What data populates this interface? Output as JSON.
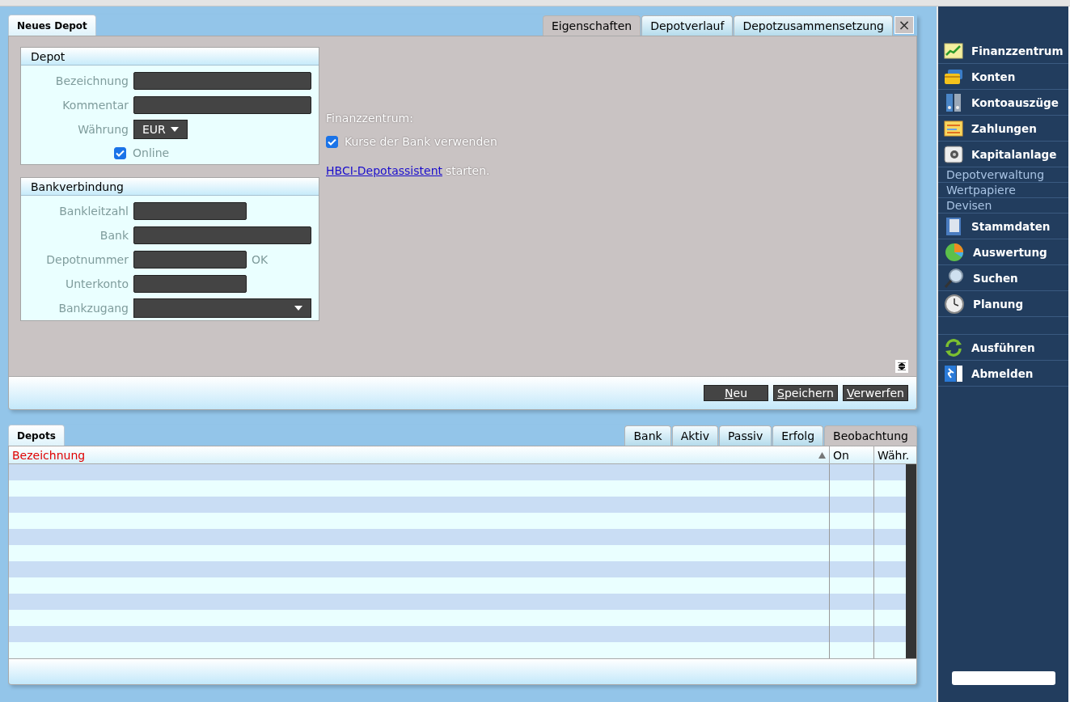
{
  "editor": {
    "title_tab": "Neues Depot",
    "tabs": [
      {
        "label": "Eigenschaften",
        "selected": true
      },
      {
        "label": "Depotverlauf",
        "selected": false
      },
      {
        "label": "Depotzusammensetzung",
        "selected": false
      }
    ],
    "close_button": "×",
    "depot_section": {
      "title": "Depot",
      "fields": [
        {
          "kind": "text",
          "label": "Bezeichnung"
        },
        {
          "kind": "text",
          "label": "Kommentar"
        },
        {
          "kind": "select",
          "label": "Währung",
          "value": "EUR"
        }
      ],
      "online": {
        "label": "Online",
        "checked": true
      }
    },
    "bank_section": {
      "title": "Bankverbindung",
      "fields": [
        {
          "kind": "number",
          "label": "Bankleitzahl"
        },
        {
          "kind": "text",
          "label": "Bank"
        },
        {
          "kind": "number",
          "label": "Depotnummer",
          "status": "OK"
        },
        {
          "kind": "number",
          "label": "Unterkonto"
        },
        {
          "kind": "dropdown",
          "label": "Bankzugang"
        }
      ]
    },
    "finanzzentrum": {
      "heading": "Finanzzentrum:",
      "use_bank_rates": {
        "label": "Kurse der Bank verwenden",
        "checked": true
      }
    },
    "assistant": {
      "link": "HBCI-Depotassistent",
      "rest": "starten."
    },
    "buttons": [
      {
        "accel": "N",
        "rest": "eu"
      },
      {
        "accel": "S",
        "rest": "peichern"
      },
      {
        "accel": "V",
        "rest": "erwerfen"
      }
    ]
  },
  "depots": {
    "title_tab": "Depots",
    "tabs": [
      {
        "label": "Bank",
        "selected": false
      },
      {
        "label": "Aktiv",
        "selected": false
      },
      {
        "label": "Passiv",
        "selected": false
      },
      {
        "label": "Erfolg",
        "selected": false
      },
      {
        "label": "Beobachtung",
        "selected": true
      }
    ],
    "columns": [
      {
        "label": "Bezeichnung",
        "sorted": true
      },
      {
        "label": "On",
        "sorted": false
      },
      {
        "label": "Währ.",
        "sorted": false
      }
    ]
  },
  "sidebar": {
    "items": [
      {
        "label": "Finanzzentrum"
      },
      {
        "label": "Konten"
      },
      {
        "label": "Kontoauszüge"
      },
      {
        "label": "Zahlungen"
      },
      {
        "label": "Kapitalanlage",
        "children": [
          {
            "label": "Depotverwaltung"
          },
          {
            "label": "Wertpapiere"
          },
          {
            "label": "Devisen"
          }
        ]
      },
      {
        "label": "Stammdaten"
      },
      {
        "label": "Auswertung"
      },
      {
        "label": "Suchen"
      },
      {
        "label": "Planung"
      }
    ],
    "actions": [
      {
        "label": "Ausführen"
      },
      {
        "label": "Abmelden"
      }
    ]
  }
}
